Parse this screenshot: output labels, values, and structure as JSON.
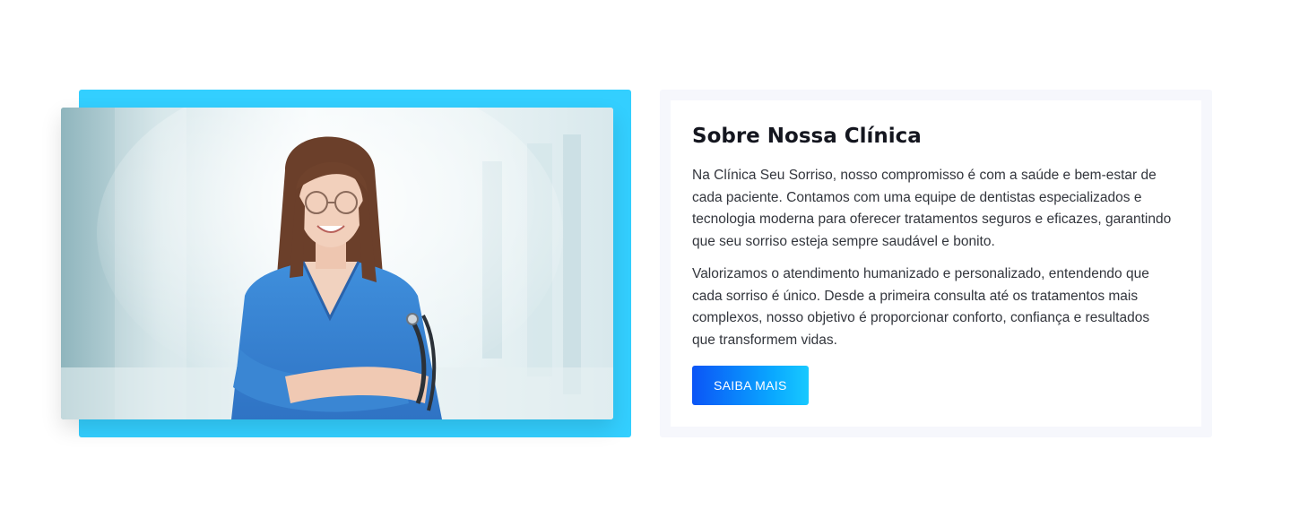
{
  "about": {
    "title": "Sobre Nossa Clínica",
    "paragraphs": [
      "Na Clínica Seu Sorriso, nosso compromisso é com a saúde e bem-estar de cada paciente. Contamos com uma equipe de dentistas especializados e tecnologia moderna para oferecer tratamentos seguros e eficazes, garantindo que seu sorriso esteja sempre saudável e bonito.",
      "Valorizamos o atendimento humanizado e personalizado, entendendo que cada sorriso é único. Desde a primeira consulta até os tratamentos mais complexos, nosso objetivo é proporcionar conforto, confiança e resultados que transformem vidas."
    ],
    "cta_label": "SAIBA MAIS"
  },
  "image": {
    "subject": "smiling female doctor in blue scrubs with stethoscope"
  },
  "colors": {
    "frame_accent": "#33cfff",
    "button_gradient_start": "#0b55f6",
    "button_gradient_end": "#18c9ff",
    "card_border": "#f6f7fc",
    "title": "#14161f",
    "body_text": "#33363d"
  }
}
